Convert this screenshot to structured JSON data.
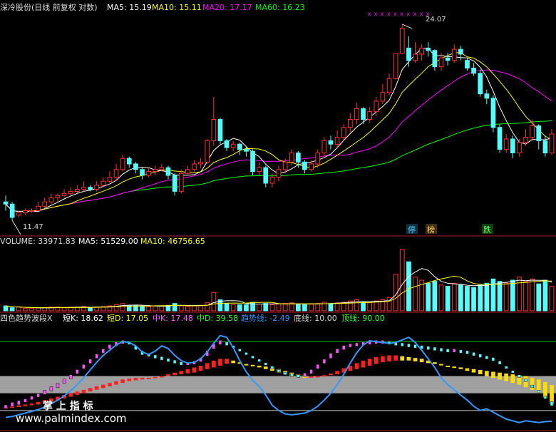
{
  "header": {
    "stock": "深冷股份(日线 前复权 对数)",
    "ma5": "MA5: 15.19",
    "ma10": "MA10: 15.11",
    "ma20": "MA20: 17.17",
    "ma60": "MA60: 16.23"
  },
  "volume_header": {
    "volume": "VOLUME: 33971.83",
    "ma5": "MA5: 51529.00",
    "ma10": "MA10: 46756.65"
  },
  "indicator_header": {
    "name": "四色趋势波段X",
    "short_k": "短K: 18.62",
    "short_d": "短D: 17.05",
    "mid_k": "中K: 17.48",
    "mid_d": "中D: 39.58",
    "trend": "趋势线: -2.49",
    "bottom": "底线: 10.00",
    "top": "顶线: 90.00"
  },
  "annotations": {
    "high": "24.07",
    "low": "11.47",
    "tags": [
      {
        "text": "停",
        "color": "#55ccff"
      },
      {
        "text": "榜",
        "color": "#ffcc66"
      },
      {
        "text": "跌",
        "color": "#66ff66"
      }
    ]
  },
  "watermark": {
    "line1": "掌 上 指 标",
    "line2": "www.palmindex.com"
  },
  "colors": {
    "up": "#ff3232",
    "down": "#54ffff",
    "ma5": "#ffffff",
    "ma10": "#ffff00",
    "ma20": "#ff00ff",
    "ma60": "#00ff00",
    "axis": "#b02020",
    "trend": "#3399ff"
  },
  "chart_data": {
    "type": "candlestick",
    "price": {
      "scale": "log",
      "ylim": [
        11.2,
        25.0
      ],
      "candles": [
        [
          12.3,
          12.2,
          12.6,
          11.9
        ],
        [
          12.2,
          11.6,
          12.3,
          11.47
        ],
        [
          11.7,
          11.8,
          11.9,
          11.6
        ],
        [
          11.8,
          11.9,
          12.0,
          11.7
        ],
        [
          11.9,
          11.9,
          12.0,
          11.8
        ],
        [
          11.9,
          12.1,
          12.3,
          11.9
        ],
        [
          12.1,
          12.3,
          12.5,
          12.0
        ],
        [
          12.3,
          12.5,
          12.7,
          12.2
        ],
        [
          12.5,
          12.6,
          12.7,
          12.3
        ],
        [
          12.6,
          12.7,
          12.9,
          12.5
        ],
        [
          12.7,
          12.8,
          13.0,
          12.6
        ],
        [
          12.8,
          12.9,
          13.1,
          12.7
        ],
        [
          12.9,
          13.0,
          13.3,
          12.8
        ],
        [
          13.0,
          12.9,
          13.1,
          12.8
        ],
        [
          12.9,
          13.1,
          13.3,
          12.8
        ],
        [
          13.1,
          13.3,
          13.5,
          13.0
        ],
        [
          13.3,
          13.5,
          13.8,
          13.2
        ],
        [
          13.5,
          13.9,
          14.2,
          13.3
        ],
        [
          13.9,
          14.5,
          14.7,
          13.8
        ],
        [
          14.5,
          14.2,
          14.6,
          14.0
        ],
        [
          14.2,
          13.9,
          14.3,
          13.7
        ],
        [
          13.9,
          13.6,
          14.0,
          13.4
        ],
        [
          13.6,
          13.8,
          14.0,
          13.5
        ],
        [
          13.8,
          13.9,
          14.1,
          13.6
        ],
        [
          13.9,
          14.0,
          14.2,
          13.8
        ],
        [
          14.0,
          13.6,
          14.1,
          13.4
        ],
        [
          13.6,
          12.8,
          13.7,
          12.6
        ],
        [
          12.8,
          13.7,
          13.9,
          12.7
        ],
        [
          13.7,
          13.9,
          14.1,
          13.6
        ],
        [
          13.9,
          14.2,
          14.4,
          13.8
        ],
        [
          14.2,
          14.3,
          14.5,
          14.0
        ],
        [
          14.3,
          15.5,
          15.6,
          14.2
        ],
        [
          15.5,
          16.8,
          18.3,
          15.2
        ],
        [
          16.8,
          15.5,
          16.9,
          15.3
        ],
        [
          15.5,
          15.1,
          15.6,
          14.9
        ],
        [
          15.1,
          15.3,
          15.5,
          14.9
        ],
        [
          15.3,
          15.0,
          15.4,
          14.7
        ],
        [
          15.0,
          14.9,
          15.2,
          14.6
        ],
        [
          14.9,
          13.8,
          15.0,
          13.6
        ],
        [
          13.8,
          14.0,
          14.3,
          13.6
        ],
        [
          14.0,
          13.2,
          14.1,
          13.0
        ],
        [
          13.2,
          13.5,
          13.7,
          13.0
        ],
        [
          13.5,
          13.9,
          14.1,
          13.3
        ],
        [
          13.9,
          14.3,
          14.5,
          13.7
        ],
        [
          14.3,
          14.8,
          15.0,
          14.1
        ],
        [
          14.8,
          14.3,
          14.9,
          14.0
        ],
        [
          14.3,
          13.9,
          14.4,
          13.7
        ],
        [
          13.9,
          14.2,
          14.4,
          13.8
        ],
        [
          14.2,
          14.8,
          15.0,
          14.0
        ],
        [
          14.8,
          15.5,
          15.7,
          14.6
        ],
        [
          15.5,
          15.3,
          15.8,
          15.0
        ],
        [
          15.3,
          15.7,
          16.1,
          15.1
        ],
        [
          15.7,
          16.3,
          16.5,
          15.5
        ],
        [
          16.3,
          16.8,
          17.2,
          16.0
        ],
        [
          16.8,
          17.5,
          17.9,
          16.5
        ],
        [
          17.5,
          16.8,
          17.6,
          16.5
        ],
        [
          16.8,
          17.3,
          17.6,
          16.6
        ],
        [
          17.3,
          18.0,
          18.3,
          17.0
        ],
        [
          18.0,
          18.6,
          19.2,
          17.8
        ],
        [
          18.6,
          19.6,
          20.0,
          18.4
        ],
        [
          19.6,
          21.56,
          21.56,
          19.5
        ],
        [
          21.56,
          23.72,
          24.07,
          21.5
        ],
        [
          22.0,
          21.0,
          23.0,
          20.5
        ],
        [
          21.0,
          21.5,
          22.5,
          20.8
        ],
        [
          21.5,
          22.0,
          22.3,
          21.0
        ],
        [
          22.0,
          21.8,
          22.5,
          21.3
        ],
        [
          21.8,
          20.5,
          21.9,
          20.2
        ],
        [
          20.5,
          21.2,
          21.6,
          20.2
        ],
        [
          21.2,
          21.0,
          21.6,
          20.6
        ],
        [
          21.0,
          21.9,
          22.3,
          20.8
        ],
        [
          21.9,
          21.5,
          22.2,
          21.0
        ],
        [
          21.0,
          20.4,
          21.2,
          20.2
        ],
        [
          20.4,
          20.0,
          20.8,
          19.8
        ],
        [
          20.0,
          18.5,
          20.3,
          18.3
        ],
        [
          18.5,
          18.2,
          18.8,
          17.8
        ],
        [
          18.2,
          16.3,
          18.4,
          16.0
        ],
        [
          16.3,
          15.0,
          16.5,
          14.8
        ],
        [
          15.0,
          15.6,
          15.9,
          14.8
        ],
        [
          15.6,
          14.8,
          15.8,
          14.5
        ],
        [
          14.8,
          15.4,
          15.6,
          14.6
        ],
        [
          15.4,
          15.7,
          16.2,
          15.2
        ],
        [
          15.7,
          16.4,
          16.8,
          15.5
        ],
        [
          16.4,
          15.5,
          16.5,
          15.0
        ],
        [
          15.5,
          14.8,
          15.8,
          14.6
        ],
        [
          14.8,
          15.9,
          16.2,
          14.7
        ]
      ]
    },
    "volume": {
      "ylim": [
        0,
        100
      ],
      "values": [
        8,
        5,
        6,
        4,
        4,
        5,
        5,
        6,
        6,
        5,
        6,
        6,
        7,
        5,
        6,
        7,
        8,
        10,
        12,
        9,
        8,
        7,
        7,
        8,
        8,
        9,
        12,
        8,
        7,
        8,
        9,
        13,
        30,
        18,
        12,
        10,
        10,
        10,
        14,
        11,
        12,
        10,
        11,
        12,
        13,
        11,
        10,
        11,
        12,
        14,
        12,
        13,
        14,
        16,
        18,
        14,
        13,
        16,
        18,
        22,
        60,
        100,
        80,
        55,
        50,
        45,
        48,
        42,
        40,
        45,
        42,
        40,
        38,
        42,
        45,
        52,
        48,
        45,
        50,
        55,
        48,
        52,
        44,
        50,
        40
      ]
    },
    "indicator": {
      "ylim": [
        -10,
        110
      ],
      "top_line": 90,
      "bottom_line": 10,
      "trend": [
        2,
        3,
        5,
        7,
        9,
        11,
        14,
        18,
        22,
        27,
        33,
        40,
        48,
        57,
        66,
        74,
        80,
        86,
        90,
        89,
        85,
        78,
        75,
        79,
        85,
        82,
        74,
        68,
        65,
        66,
        70,
        78,
        88,
        97,
        95,
        83,
        68,
        55,
        45,
        38,
        28,
        16,
        10,
        6,
        5,
        6,
        7,
        10,
        15,
        22,
        30,
        40,
        52,
        65,
        77,
        86,
        91,
        90,
        89,
        88,
        89,
        92,
        95,
        89,
        80,
        70,
        60,
        48,
        40,
        34,
        28,
        22,
        15,
        10,
        12,
        8,
        4,
        0,
        -2,
        -4,
        -2,
        -3,
        -4,
        -3,
        -2.49
      ],
      "short_k": [
        15,
        18,
        20,
        22,
        25,
        28,
        32,
        36,
        40,
        45,
        50,
        56,
        62,
        68,
        74,
        80,
        85,
        88,
        90,
        88,
        82,
        76,
        74,
        72,
        70,
        68,
        66,
        64,
        64,
        66,
        70,
        78,
        86,
        90,
        88,
        84,
        80,
        76,
        72,
        68,
        64,
        60,
        56,
        53,
        51,
        50,
        52,
        56,
        62,
        68,
        75,
        80,
        84,
        86,
        87,
        88,
        89,
        90,
        90,
        89,
        88,
        87,
        86,
        85,
        84,
        83,
        82,
        81,
        80,
        80,
        79,
        78,
        76,
        74,
        72,
        70,
        66,
        60,
        55,
        50,
        45,
        38,
        32,
        25,
        18.62
      ],
      "short_d": [
        14,
        16,
        18,
        21,
        24,
        27,
        30,
        34,
        38,
        43,
        48,
        54,
        60,
        66,
        72,
        78,
        83,
        86,
        89,
        88,
        84,
        78,
        75,
        73,
        71,
        69,
        67,
        65,
        64,
        65,
        68,
        75,
        83,
        88,
        87,
        84,
        80,
        76,
        72,
        68,
        64,
        60,
        56,
        53,
        51,
        50,
        51,
        54,
        60,
        66,
        72,
        78,
        82,
        85,
        86,
        87,
        88,
        89,
        89,
        88,
        87,
        86,
        85,
        84,
        83,
        82,
        81,
        80,
        79,
        79,
        78,
        77,
        75,
        73,
        71,
        69,
        65,
        60,
        55,
        50,
        45,
        38,
        32,
        25,
        17.05
      ],
      "mid_k": [
        14,
        15,
        16,
        17,
        18,
        20,
        22,
        24,
        26,
        28,
        30,
        32,
        34,
        36,
        38,
        40,
        42,
        44,
        46,
        47,
        48,
        48,
        48,
        49,
        50,
        52,
        54,
        56,
        58,
        60,
        62,
        65,
        68,
        70,
        70,
        68,
        66,
        64,
        62,
        60,
        58,
        56,
        54,
        52,
        50,
        49,
        48,
        48,
        49,
        51,
        53,
        56,
        59,
        62,
        65,
        68,
        70,
        72,
        73,
        74,
        74,
        73,
        72,
        71,
        70,
        68,
        66,
        64,
        62,
        60,
        58,
        56,
        54,
        52,
        50,
        48,
        46,
        44,
        42,
        40,
        37,
        34,
        30,
        25,
        17.48
      ],
      "mid_d": [
        12,
        13,
        14,
        15,
        16,
        17,
        19,
        20,
        22,
        24,
        26,
        28,
        30,
        32,
        34,
        36,
        38,
        40,
        42,
        44,
        45,
        46,
        47,
        48,
        49,
        50,
        51,
        52,
        53,
        54,
        56,
        58,
        60,
        62,
        64,
        65,
        65,
        64,
        63,
        62,
        61,
        60,
        58,
        56,
        54,
        52,
        51,
        50,
        50,
        50,
        51,
        52,
        54,
        56,
        58,
        60,
        62,
        64,
        66,
        67,
        68,
        68,
        68,
        67,
        66,
        65,
        64,
        63,
        62,
        61,
        60,
        59,
        58,
        57,
        56,
        55,
        54,
        53,
        52,
        51,
        50,
        48,
        46,
        43,
        39.58
      ]
    }
  }
}
